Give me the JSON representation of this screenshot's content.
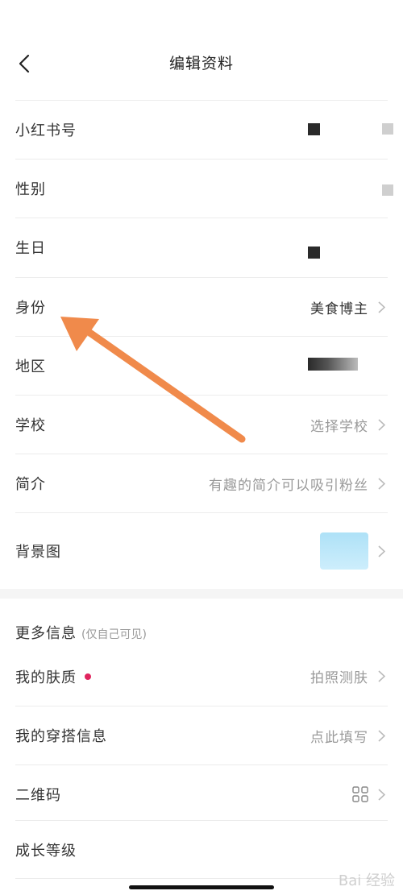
{
  "header": {
    "title": "编辑资料",
    "back_icon": "chevron-left-icon"
  },
  "rows": {
    "xiaohongshu_id": {
      "label": "小红书号"
    },
    "gender": {
      "label": "性别"
    },
    "birthday": {
      "label": "生日"
    },
    "identity": {
      "label": "身份",
      "value": "美食博主"
    },
    "region": {
      "label": "地区"
    },
    "school": {
      "label": "学校",
      "value": "选择学校"
    },
    "bio": {
      "label": "简介",
      "value": "有趣的简介可以吸引粉丝"
    },
    "background": {
      "label": "背景图"
    }
  },
  "more": {
    "title": "更多信息",
    "subtitle": "(仅自己可见)",
    "skin": {
      "label": "我的肤质",
      "value": "拍照测肤"
    },
    "outfit": {
      "label": "我的穿搭信息",
      "value": "点此填写"
    },
    "qrcode": {
      "label": "二维码"
    },
    "growth": {
      "label": "成长等级"
    }
  },
  "colors": {
    "accent_arrow": "#f08a4b",
    "red_dot": "#e0245e",
    "secondary_text": "#999999"
  },
  "watermark": "Bai 经验"
}
